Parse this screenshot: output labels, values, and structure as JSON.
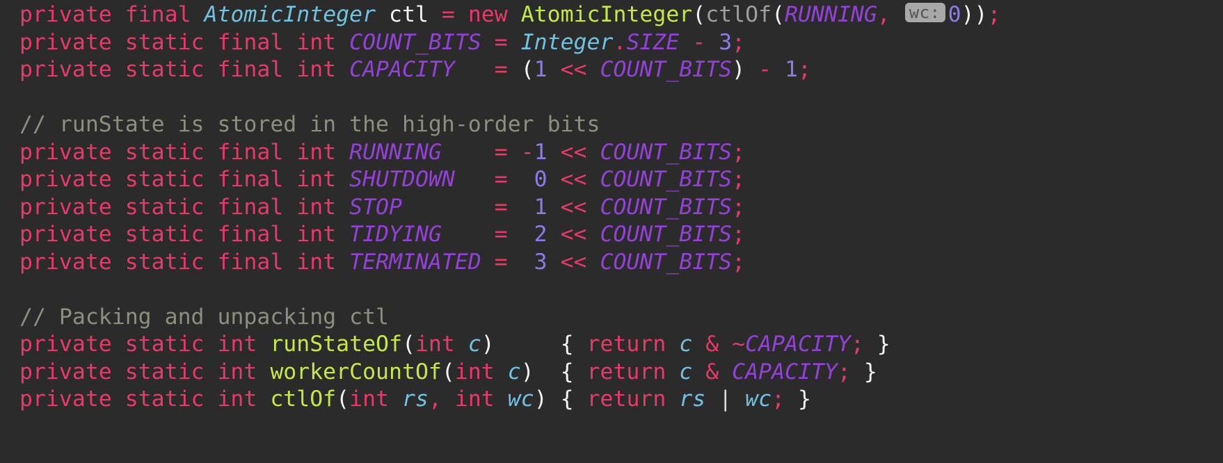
{
  "editor": {
    "background_color": "#2b2b2b",
    "language": "java",
    "font_size_px": 31.5
  },
  "palette": {
    "keyword": "#e8396b",
    "class_type": "#6fc3e0",
    "constant": "#9341d6",
    "method": "#c5e944",
    "number": "#8f7ae8",
    "comment": "#8d8f7e",
    "parameter": "#6fc3e0",
    "punctuation": "#f5f5f5",
    "dimmed_call": "#9e9e9e",
    "hint_background": "#a8a8a8",
    "hint_text": "#555555"
  },
  "inlay_hint": {
    "label": "wc:",
    "for_argument": "0"
  },
  "lines": [
    {
      "n": 1,
      "text": "private final AtomicInteger ctl = new AtomicInteger(ctlOf(RUNNING, wc: 0));",
      "tokens": [
        {
          "t": "private final ",
          "c": "kw"
        },
        {
          "t": "AtomicInteger",
          "c": "type-cls"
        },
        {
          "t": " ",
          "c": "plain"
        },
        {
          "t": "ctl",
          "c": "plain"
        },
        {
          "t": " ",
          "c": "plain"
        },
        {
          "t": "=",
          "c": "op"
        },
        {
          "t": " ",
          "c": "plain"
        },
        {
          "t": "new",
          "c": "kw"
        },
        {
          "t": " ",
          "c": "plain"
        },
        {
          "t": "AtomicInteger",
          "c": "method"
        },
        {
          "t": "(",
          "c": "punc"
        },
        {
          "t": "ctlOf",
          "c": "method-d"
        },
        {
          "t": "(",
          "c": "punc"
        },
        {
          "t": "RUNNING",
          "c": "const"
        },
        {
          "t": ",",
          "c": "semi"
        },
        {
          "t": " ",
          "c": "plain"
        },
        {
          "t": "wc:",
          "c": "hint"
        },
        {
          "t": "0",
          "c": "num"
        },
        {
          "t": "))",
          "c": "punc"
        },
        {
          "t": ";",
          "c": "semi"
        }
      ]
    },
    {
      "n": 2,
      "text": "private static final int COUNT_BITS = Integer.SIZE - 3;",
      "tokens": [
        {
          "t": "private static final int ",
          "c": "kw"
        },
        {
          "t": "COUNT_BITS",
          "c": "const"
        },
        {
          "t": " ",
          "c": "plain"
        },
        {
          "t": "=",
          "c": "op"
        },
        {
          "t": " ",
          "c": "plain"
        },
        {
          "t": "Integer",
          "c": "type-cls"
        },
        {
          "t": ".",
          "c": "op"
        },
        {
          "t": "SIZE",
          "c": "const"
        },
        {
          "t": " ",
          "c": "plain"
        },
        {
          "t": "-",
          "c": "op"
        },
        {
          "t": " ",
          "c": "plain"
        },
        {
          "t": "3",
          "c": "num"
        },
        {
          "t": ";",
          "c": "semi"
        }
      ]
    },
    {
      "n": 3,
      "text": "private static final int CAPACITY   = (1 << COUNT_BITS) - 1;",
      "tokens": [
        {
          "t": "private static final int ",
          "c": "kw"
        },
        {
          "t": "CAPACITY",
          "c": "const"
        },
        {
          "t": "   ",
          "c": "plain"
        },
        {
          "t": "=",
          "c": "op"
        },
        {
          "t": " ",
          "c": "plain"
        },
        {
          "t": "(",
          "c": "punc"
        },
        {
          "t": "1",
          "c": "num"
        },
        {
          "t": " ",
          "c": "plain"
        },
        {
          "t": "<<",
          "c": "op"
        },
        {
          "t": " ",
          "c": "plain"
        },
        {
          "t": "COUNT_BITS",
          "c": "const"
        },
        {
          "t": ")",
          "c": "punc"
        },
        {
          "t": " ",
          "c": "plain"
        },
        {
          "t": "-",
          "c": "op"
        },
        {
          "t": " ",
          "c": "plain"
        },
        {
          "t": "1",
          "c": "num"
        },
        {
          "t": ";",
          "c": "semi"
        }
      ]
    },
    {
      "n": 4,
      "text": "",
      "tokens": []
    },
    {
      "n": 5,
      "text": "// runState is stored in the high-order bits",
      "tokens": [
        {
          "t": "// runState is stored in the high-order bits",
          "c": "comment"
        }
      ]
    },
    {
      "n": 6,
      "text": "private static final int RUNNING    = -1 << COUNT_BITS;",
      "tokens": [
        {
          "t": "private static final int ",
          "c": "kw"
        },
        {
          "t": "RUNNING",
          "c": "const"
        },
        {
          "t": "    ",
          "c": "plain"
        },
        {
          "t": "=",
          "c": "op"
        },
        {
          "t": " ",
          "c": "plain"
        },
        {
          "t": "-",
          "c": "op"
        },
        {
          "t": "1",
          "c": "num"
        },
        {
          "t": " ",
          "c": "plain"
        },
        {
          "t": "<<",
          "c": "op"
        },
        {
          "t": " ",
          "c": "plain"
        },
        {
          "t": "COUNT_BITS",
          "c": "const"
        },
        {
          "t": ";",
          "c": "semi"
        }
      ]
    },
    {
      "n": 7,
      "text": "private static final int SHUTDOWN   =  0 << COUNT_BITS;",
      "tokens": [
        {
          "t": "private static final int ",
          "c": "kw"
        },
        {
          "t": "SHUTDOWN",
          "c": "const"
        },
        {
          "t": "   ",
          "c": "plain"
        },
        {
          "t": "=",
          "c": "op"
        },
        {
          "t": "  ",
          "c": "plain"
        },
        {
          "t": "0",
          "c": "num"
        },
        {
          "t": " ",
          "c": "plain"
        },
        {
          "t": "<<",
          "c": "op"
        },
        {
          "t": " ",
          "c": "plain"
        },
        {
          "t": "COUNT_BITS",
          "c": "const"
        },
        {
          "t": ";",
          "c": "semi"
        }
      ]
    },
    {
      "n": 8,
      "text": "private static final int STOP       =  1 << COUNT_BITS;",
      "tokens": [
        {
          "t": "private static final int ",
          "c": "kw"
        },
        {
          "t": "STOP",
          "c": "const"
        },
        {
          "t": "       ",
          "c": "plain"
        },
        {
          "t": "=",
          "c": "op"
        },
        {
          "t": "  ",
          "c": "plain"
        },
        {
          "t": "1",
          "c": "num"
        },
        {
          "t": " ",
          "c": "plain"
        },
        {
          "t": "<<",
          "c": "op"
        },
        {
          "t": " ",
          "c": "plain"
        },
        {
          "t": "COUNT_BITS",
          "c": "const"
        },
        {
          "t": ";",
          "c": "semi"
        }
      ]
    },
    {
      "n": 9,
      "text": "private static final int TIDYING    =  2 << COUNT_BITS;",
      "tokens": [
        {
          "t": "private static final int ",
          "c": "kw"
        },
        {
          "t": "TIDYING",
          "c": "const"
        },
        {
          "t": "    ",
          "c": "plain"
        },
        {
          "t": "=",
          "c": "op"
        },
        {
          "t": "  ",
          "c": "plain"
        },
        {
          "t": "2",
          "c": "num"
        },
        {
          "t": " ",
          "c": "plain"
        },
        {
          "t": "<<",
          "c": "op"
        },
        {
          "t": " ",
          "c": "plain"
        },
        {
          "t": "COUNT_BITS",
          "c": "const"
        },
        {
          "t": ";",
          "c": "semi"
        }
      ]
    },
    {
      "n": 10,
      "text": "private static final int TERMINATED =  3 << COUNT_BITS;",
      "tokens": [
        {
          "t": "private static final int ",
          "c": "kw"
        },
        {
          "t": "TERMINATED",
          "c": "const"
        },
        {
          "t": " ",
          "c": "plain"
        },
        {
          "t": "=",
          "c": "op"
        },
        {
          "t": "  ",
          "c": "plain"
        },
        {
          "t": "3",
          "c": "num"
        },
        {
          "t": " ",
          "c": "plain"
        },
        {
          "t": "<<",
          "c": "op"
        },
        {
          "t": " ",
          "c": "plain"
        },
        {
          "t": "COUNT_BITS",
          "c": "const"
        },
        {
          "t": ";",
          "c": "semi"
        }
      ]
    },
    {
      "n": 11,
      "text": "",
      "tokens": []
    },
    {
      "n": 12,
      "text": "// Packing and unpacking ctl",
      "tokens": [
        {
          "t": "// Packing and unpacking ctl",
          "c": "comment"
        }
      ]
    },
    {
      "n": 13,
      "text": "private static int runStateOf(int c)     { return c & ~CAPACITY; }",
      "tokens": [
        {
          "t": "private static int ",
          "c": "kw"
        },
        {
          "t": "runStateOf",
          "c": "method"
        },
        {
          "t": "(",
          "c": "punc"
        },
        {
          "t": "int",
          "c": "kw"
        },
        {
          "t": " ",
          "c": "plain"
        },
        {
          "t": "c",
          "c": "param"
        },
        {
          "t": ")",
          "c": "punc"
        },
        {
          "t": "     ",
          "c": "plain"
        },
        {
          "t": "{",
          "c": "punc"
        },
        {
          "t": " ",
          "c": "plain"
        },
        {
          "t": "return",
          "c": "kw"
        },
        {
          "t": " ",
          "c": "plain"
        },
        {
          "t": "c",
          "c": "param"
        },
        {
          "t": " ",
          "c": "plain"
        },
        {
          "t": "&",
          "c": "op"
        },
        {
          "t": " ",
          "c": "plain"
        },
        {
          "t": "~",
          "c": "op"
        },
        {
          "t": "CAPACITY",
          "c": "const"
        },
        {
          "t": ";",
          "c": "semi"
        },
        {
          "t": " ",
          "c": "plain"
        },
        {
          "t": "}",
          "c": "punc"
        }
      ]
    },
    {
      "n": 14,
      "text": "private static int workerCountOf(int c)  { return c & CAPACITY; }",
      "tokens": [
        {
          "t": "private static int ",
          "c": "kw"
        },
        {
          "t": "workerCountOf",
          "c": "method"
        },
        {
          "t": "(",
          "c": "punc"
        },
        {
          "t": "int",
          "c": "kw"
        },
        {
          "t": " ",
          "c": "plain"
        },
        {
          "t": "c",
          "c": "param"
        },
        {
          "t": ")",
          "c": "punc"
        },
        {
          "t": "  ",
          "c": "plain"
        },
        {
          "t": "{",
          "c": "punc"
        },
        {
          "t": " ",
          "c": "plain"
        },
        {
          "t": "return",
          "c": "kw"
        },
        {
          "t": " ",
          "c": "plain"
        },
        {
          "t": "c",
          "c": "param"
        },
        {
          "t": " ",
          "c": "plain"
        },
        {
          "t": "&",
          "c": "op"
        },
        {
          "t": " ",
          "c": "plain"
        },
        {
          "t": "CAPACITY",
          "c": "const"
        },
        {
          "t": ";",
          "c": "semi"
        },
        {
          "t": " ",
          "c": "plain"
        },
        {
          "t": "}",
          "c": "punc"
        }
      ]
    },
    {
      "n": 15,
      "text": "private static int ctlOf(int rs, int wc) { return rs | wc; }",
      "tokens": [
        {
          "t": "private static int ",
          "c": "kw"
        },
        {
          "t": "ctlOf",
          "c": "method"
        },
        {
          "t": "(",
          "c": "punc"
        },
        {
          "t": "int",
          "c": "kw"
        },
        {
          "t": " ",
          "c": "plain"
        },
        {
          "t": "rs",
          "c": "param"
        },
        {
          "t": ",",
          "c": "semi"
        },
        {
          "t": " ",
          "c": "plain"
        },
        {
          "t": "int",
          "c": "kw"
        },
        {
          "t": " ",
          "c": "plain"
        },
        {
          "t": "wc",
          "c": "param"
        },
        {
          "t": ")",
          "c": "punc"
        },
        {
          "t": " ",
          "c": "plain"
        },
        {
          "t": "{",
          "c": "punc"
        },
        {
          "t": " ",
          "c": "plain"
        },
        {
          "t": "return",
          "c": "kw"
        },
        {
          "t": " ",
          "c": "plain"
        },
        {
          "t": "rs",
          "c": "param"
        },
        {
          "t": " ",
          "c": "plain"
        },
        {
          "t": "|",
          "c": "pipe"
        },
        {
          "t": " ",
          "c": "plain"
        },
        {
          "t": "wc",
          "c": "param"
        },
        {
          "t": ";",
          "c": "semi"
        },
        {
          "t": " ",
          "c": "plain"
        },
        {
          "t": "}",
          "c": "punc"
        }
      ]
    }
  ]
}
